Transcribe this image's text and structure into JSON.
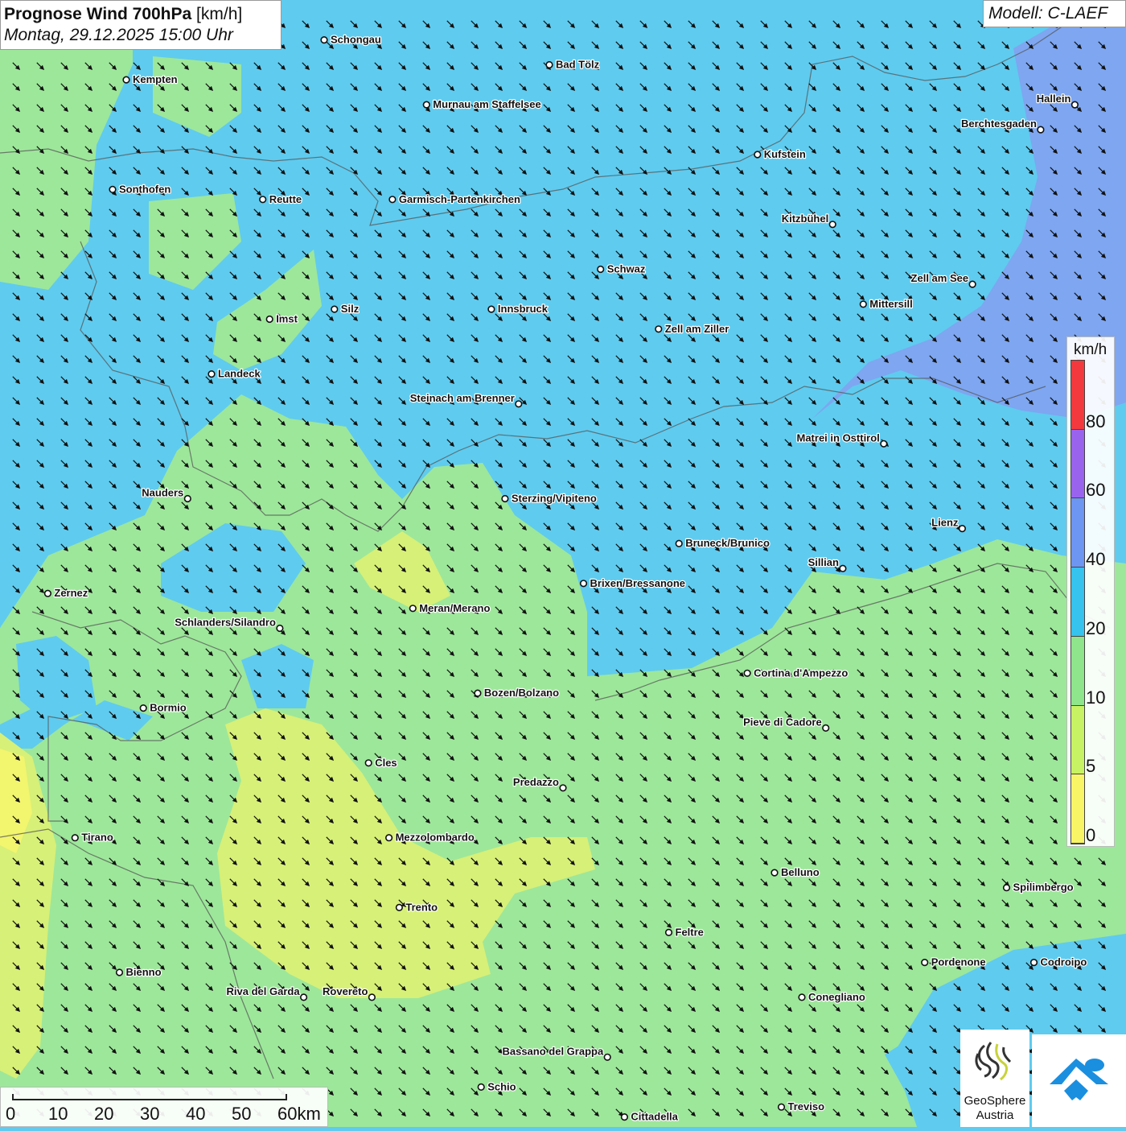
{
  "header": {
    "title_bold": "Prognose Wind 700hPa",
    "title_unit": "[km/h]",
    "datetime": "Montag, 29.12.2025 15:00 Uhr",
    "model": "Modell: C-LAEF"
  },
  "legend": {
    "unit": "km/h",
    "segments": [
      {
        "from": 0,
        "to": 5,
        "color": "#f8f566"
      },
      {
        "from": 5,
        "to": 10,
        "color": "#c7f263"
      },
      {
        "from": 10,
        "to": 20,
        "color": "#8fe58b"
      },
      {
        "from": 20,
        "to": 40,
        "color": "#36c3ee"
      },
      {
        "from": 40,
        "to": 60,
        "color": "#6d95f2"
      },
      {
        "from": 60,
        "to": 80,
        "color": "#9a63ee"
      },
      {
        "from": 80,
        "to": 100,
        "color": "#f3393d"
      }
    ],
    "ticks": [
      "0",
      "5",
      "10",
      "20",
      "40",
      "60",
      "80"
    ]
  },
  "scalebar": {
    "labels": [
      "0",
      "10",
      "20",
      "30",
      "40",
      "50",
      "60km"
    ],
    "max_km": 60
  },
  "wind": {
    "direction_deg": 135,
    "description": "arrows pointing toward south-east"
  },
  "colors": {
    "zone_0_5": "#f2f56e",
    "zone_5_10": "#d7f077",
    "zone_10_20": "#9de79a",
    "zone_20_40": "#5fcbef",
    "zone_40_60": "#7ea6f1"
  },
  "logos": {
    "geosphere_line1": "GeoSphere",
    "geosphere_line2": "Austria"
  },
  "cities": [
    {
      "name": "Schongau",
      "lon": 10.9,
      "lat": 47.81,
      "anchor": "left"
    },
    {
      "name": "Bad Tölz",
      "lon": 11.56,
      "lat": 47.76,
      "anchor": "left"
    },
    {
      "name": "Kempten",
      "lon": 10.32,
      "lat": 47.73,
      "anchor": "left"
    },
    {
      "name": "Murnau am Staffelsee",
      "lon": 11.2,
      "lat": 47.68,
      "anchor": "left"
    },
    {
      "name": "Hallein",
      "lon": 13.1,
      "lat": 47.68,
      "anchor": "right"
    },
    {
      "name": "Berchtesgaden",
      "lon": 13.0,
      "lat": 47.63,
      "anchor": "right"
    },
    {
      "name": "Kufstein",
      "lon": 12.17,
      "lat": 47.58,
      "anchor": "left"
    },
    {
      "name": "Sonthofen",
      "lon": 10.28,
      "lat": 47.51,
      "anchor": "left"
    },
    {
      "name": "Reutte",
      "lon": 10.72,
      "lat": 47.49,
      "anchor": "left"
    },
    {
      "name": "Garmisch-Partenkirchen",
      "lon": 11.1,
      "lat": 47.49,
      "anchor": "left"
    },
    {
      "name": "Kitzbühel",
      "lon": 12.39,
      "lat": 47.44,
      "anchor": "right"
    },
    {
      "name": "Schwaz",
      "lon": 11.71,
      "lat": 47.35,
      "anchor": "left"
    },
    {
      "name": "Zell am See",
      "lon": 12.8,
      "lat": 47.32,
      "anchor": "right"
    },
    {
      "name": "Mittersill",
      "lon": 12.48,
      "lat": 47.28,
      "anchor": "left"
    },
    {
      "name": "Silz",
      "lon": 10.93,
      "lat": 47.27,
      "anchor": "left"
    },
    {
      "name": "Innsbruck",
      "lon": 11.39,
      "lat": 47.27,
      "anchor": "left"
    },
    {
      "name": "Imst",
      "lon": 10.74,
      "lat": 47.25,
      "anchor": "left"
    },
    {
      "name": "Zell am Ziller",
      "lon": 11.88,
      "lat": 47.23,
      "anchor": "left"
    },
    {
      "name": "Landeck",
      "lon": 10.57,
      "lat": 47.14,
      "anchor": "left"
    },
    {
      "name": "Steinach am Brenner",
      "lon": 11.47,
      "lat": 47.08,
      "anchor": "right"
    },
    {
      "name": "Matrei in Osttirol",
      "lon": 12.54,
      "lat": 47.0,
      "anchor": "right"
    },
    {
      "name": "Nauders",
      "lon": 10.5,
      "lat": 46.89,
      "anchor": "right"
    },
    {
      "name": "Sterzing/Vipiteno",
      "lon": 11.43,
      "lat": 46.89,
      "anchor": "left"
    },
    {
      "name": "Lienz",
      "lon": 12.77,
      "lat": 46.83,
      "anchor": "right"
    },
    {
      "name": "Bruneck/Brunico",
      "lon": 11.94,
      "lat": 46.8,
      "anchor": "left"
    },
    {
      "name": "Sillian",
      "lon": 12.42,
      "lat": 46.75,
      "anchor": "right"
    },
    {
      "name": "Brixen/Bressanone",
      "lon": 11.66,
      "lat": 46.72,
      "anchor": "left"
    },
    {
      "name": "Zernez",
      "lon": 10.09,
      "lat": 46.7,
      "anchor": "left"
    },
    {
      "name": "Meran/Merano",
      "lon": 11.16,
      "lat": 46.67,
      "anchor": "left"
    },
    {
      "name": "Schlanders/Silandro",
      "lon": 10.77,
      "lat": 46.63,
      "anchor": "right"
    },
    {
      "name": "Cortina d'Ampezzo",
      "lon": 12.14,
      "lat": 46.54,
      "anchor": "left"
    },
    {
      "name": "Bozen/Bolzano",
      "lon": 11.35,
      "lat": 46.5,
      "anchor": "left"
    },
    {
      "name": "Bormio",
      "lon": 10.37,
      "lat": 46.47,
      "anchor": "left"
    },
    {
      "name": "Pieve di Cadore",
      "lon": 12.37,
      "lat": 46.43,
      "anchor": "right"
    },
    {
      "name": "Cles",
      "lon": 11.03,
      "lat": 46.36,
      "anchor": "left"
    },
    {
      "name": "Predazzo",
      "lon": 11.6,
      "lat": 46.31,
      "anchor": "right"
    },
    {
      "name": "Tirano",
      "lon": 10.17,
      "lat": 46.21,
      "anchor": "left"
    },
    {
      "name": "Mezzolombardo",
      "lon": 11.09,
      "lat": 46.21,
      "anchor": "left"
    },
    {
      "name": "Belluno",
      "lon": 12.22,
      "lat": 46.14,
      "anchor": "left"
    },
    {
      "name": "Spilimbergo",
      "lon": 12.9,
      "lat": 46.11,
      "anchor": "left"
    },
    {
      "name": "Trento",
      "lon": 11.12,
      "lat": 46.07,
      "anchor": "left"
    },
    {
      "name": "Feltre",
      "lon": 11.91,
      "lat": 46.02,
      "anchor": "left"
    },
    {
      "name": "Bienno",
      "lon": 10.3,
      "lat": 45.94,
      "anchor": "left"
    },
    {
      "name": "Pordenone",
      "lon": 12.66,
      "lat": 45.96,
      "anchor": "left"
    },
    {
      "name": "Codroipo",
      "lon": 12.98,
      "lat": 45.96,
      "anchor": "left"
    },
    {
      "name": "Riva del Garda",
      "lon": 10.84,
      "lat": 45.89,
      "anchor": "right"
    },
    {
      "name": "Rovereto",
      "lon": 11.04,
      "lat": 45.89,
      "anchor": "right"
    },
    {
      "name": "Conegliano",
      "lon": 12.3,
      "lat": 45.89,
      "anchor": "left"
    },
    {
      "name": "Bassano del Grappa",
      "lon": 11.73,
      "lat": 45.77,
      "anchor": "right"
    },
    {
      "name": "Schio",
      "lon": 11.36,
      "lat": 45.71,
      "anchor": "left"
    },
    {
      "name": "Treviso",
      "lon": 12.24,
      "lat": 45.67,
      "anchor": "left"
    },
    {
      "name": "Cittadella",
      "lon": 11.78,
      "lat": 45.65,
      "anchor": "left"
    }
  ]
}
